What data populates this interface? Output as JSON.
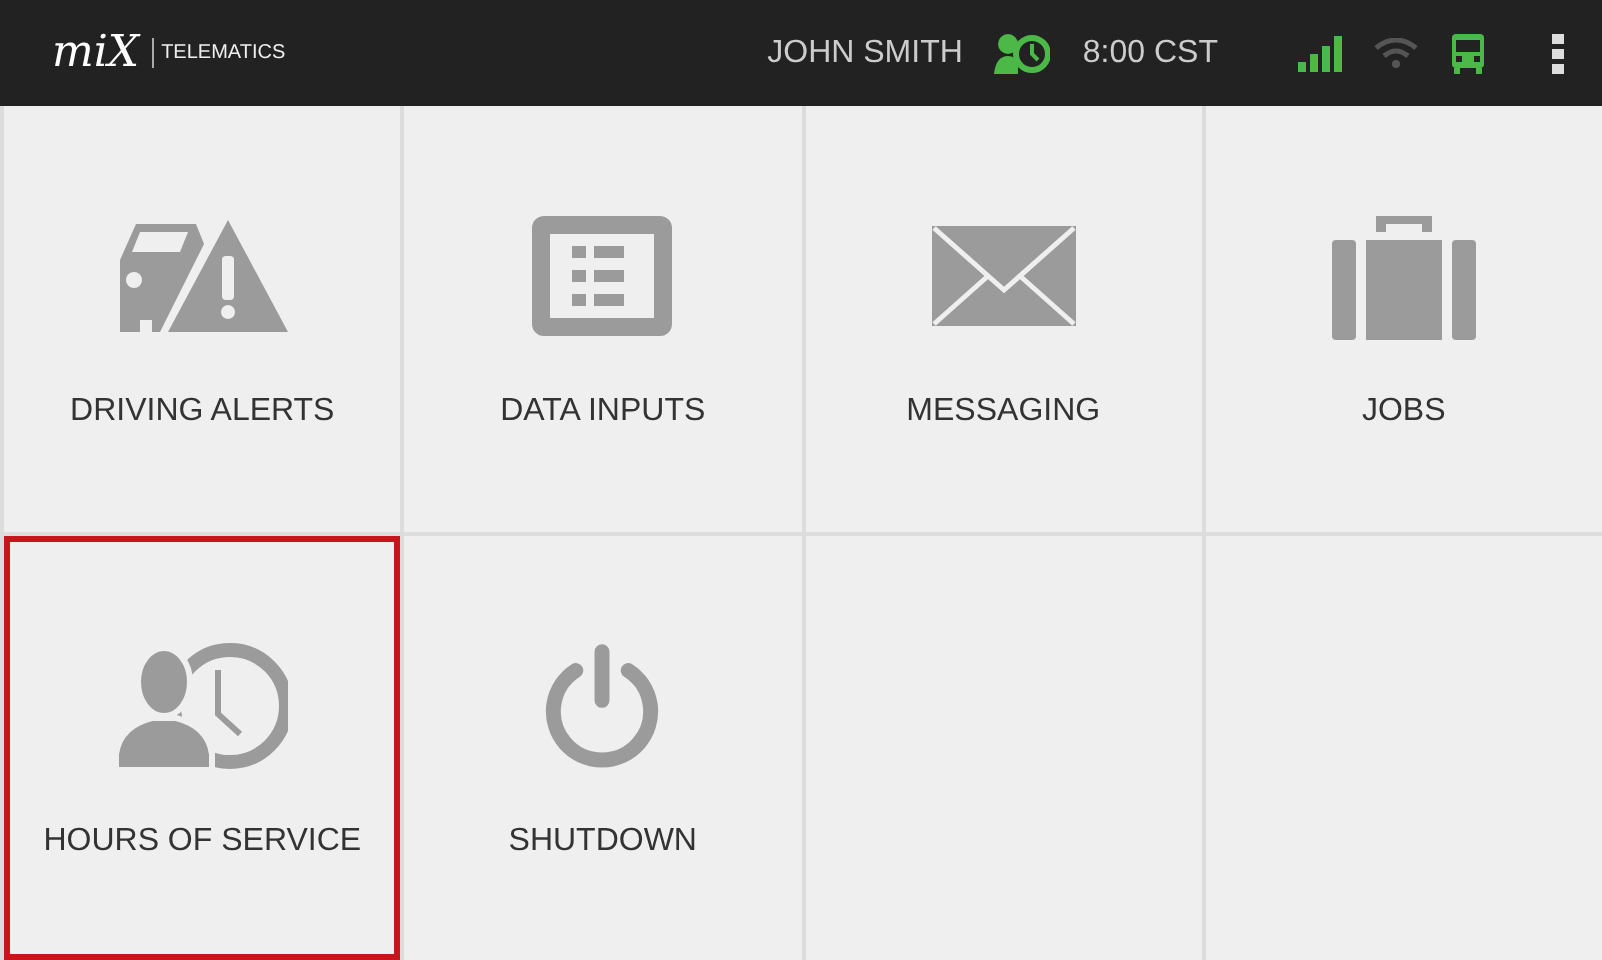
{
  "header": {
    "logo": "miX",
    "product": "TELEMATICS",
    "driver": "JOHN SMITH",
    "time": "8:00 CST",
    "signal_on": true,
    "wifi_on": false,
    "vehicle_on": true
  },
  "tiles": [
    {
      "kind": "driving-alerts",
      "label": "DRIVING ALERTS",
      "selected": false
    },
    {
      "kind": "data-inputs",
      "label": "DATA INPUTS",
      "selected": false
    },
    {
      "kind": "messaging",
      "label": "MESSAGING",
      "selected": false
    },
    {
      "kind": "jobs",
      "label": "JOBS",
      "selected": false
    },
    {
      "kind": "hours-of-service",
      "label": "HOURS OF SERVICE",
      "selected": true
    },
    {
      "kind": "shutdown",
      "label": "SHUTDOWN",
      "selected": false
    },
    {
      "kind": "empty",
      "selected": false
    },
    {
      "kind": "empty",
      "selected": false
    }
  ]
}
